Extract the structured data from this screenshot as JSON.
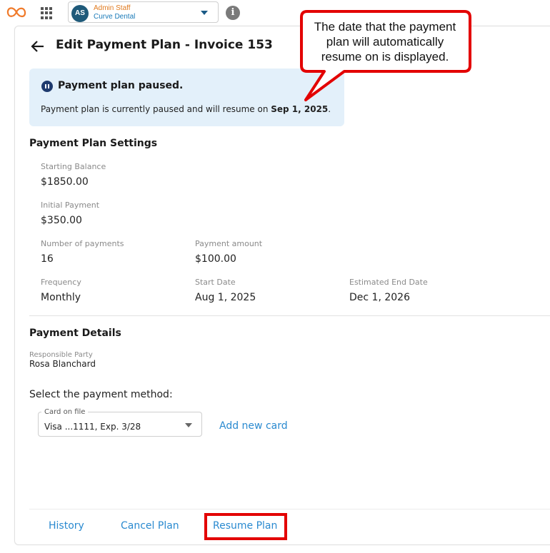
{
  "topbar": {
    "avatar_initials": "AS",
    "account_name": "Admin Staff",
    "account_org": "Curve Dental",
    "icons": [
      "curve-logo-icon",
      "apps-grid-icon",
      "chevron-down-icon",
      "info-icon"
    ]
  },
  "header": {
    "title": "Edit Payment Plan - Invoice 153"
  },
  "banner": {
    "title": "Payment plan paused.",
    "text_prefix": "Payment plan is currently paused and will resume on ",
    "resume_date": "Sep 1, 2025",
    "text_suffix": "."
  },
  "settings": {
    "heading": "Payment Plan Settings",
    "starting_balance": {
      "label": "Starting Balance",
      "value": "$1850.00"
    },
    "initial_payment": {
      "label": "Initial Payment",
      "value": "$350.00"
    },
    "number_of_payments": {
      "label": "Number of payments",
      "value": "16"
    },
    "payment_amount": {
      "label": "Payment amount",
      "value": "$100.00"
    },
    "frequency": {
      "label": "Frequency",
      "value": "Monthly"
    },
    "start_date": {
      "label": "Start Date",
      "value": "Aug 1, 2025"
    },
    "end_date": {
      "label": "Estimated End Date",
      "value": "Dec 1, 2026"
    }
  },
  "details": {
    "heading": "Payment Details",
    "responsible_party_label": "Responsible Party",
    "responsible_party_value": "Rosa Blanchard",
    "method_label": "Select the payment method:",
    "card_select_label": "Card on file",
    "card_select_value": "Visa ...1111, Exp. 3/28",
    "add_card_label": "Add new card"
  },
  "footer": {
    "history_label": "History",
    "cancel_label": "Cancel Plan",
    "resume_label": "Resume Plan"
  },
  "callout": {
    "text": "The date that the payment plan will automatically resume on is displayed."
  },
  "colors": {
    "accent": "#2a8ad0",
    "banner_bg": "#e3f0fa",
    "highlight_red": "#e30000",
    "account_name": "#e07a1f",
    "account_org": "#1a7ab8"
  }
}
